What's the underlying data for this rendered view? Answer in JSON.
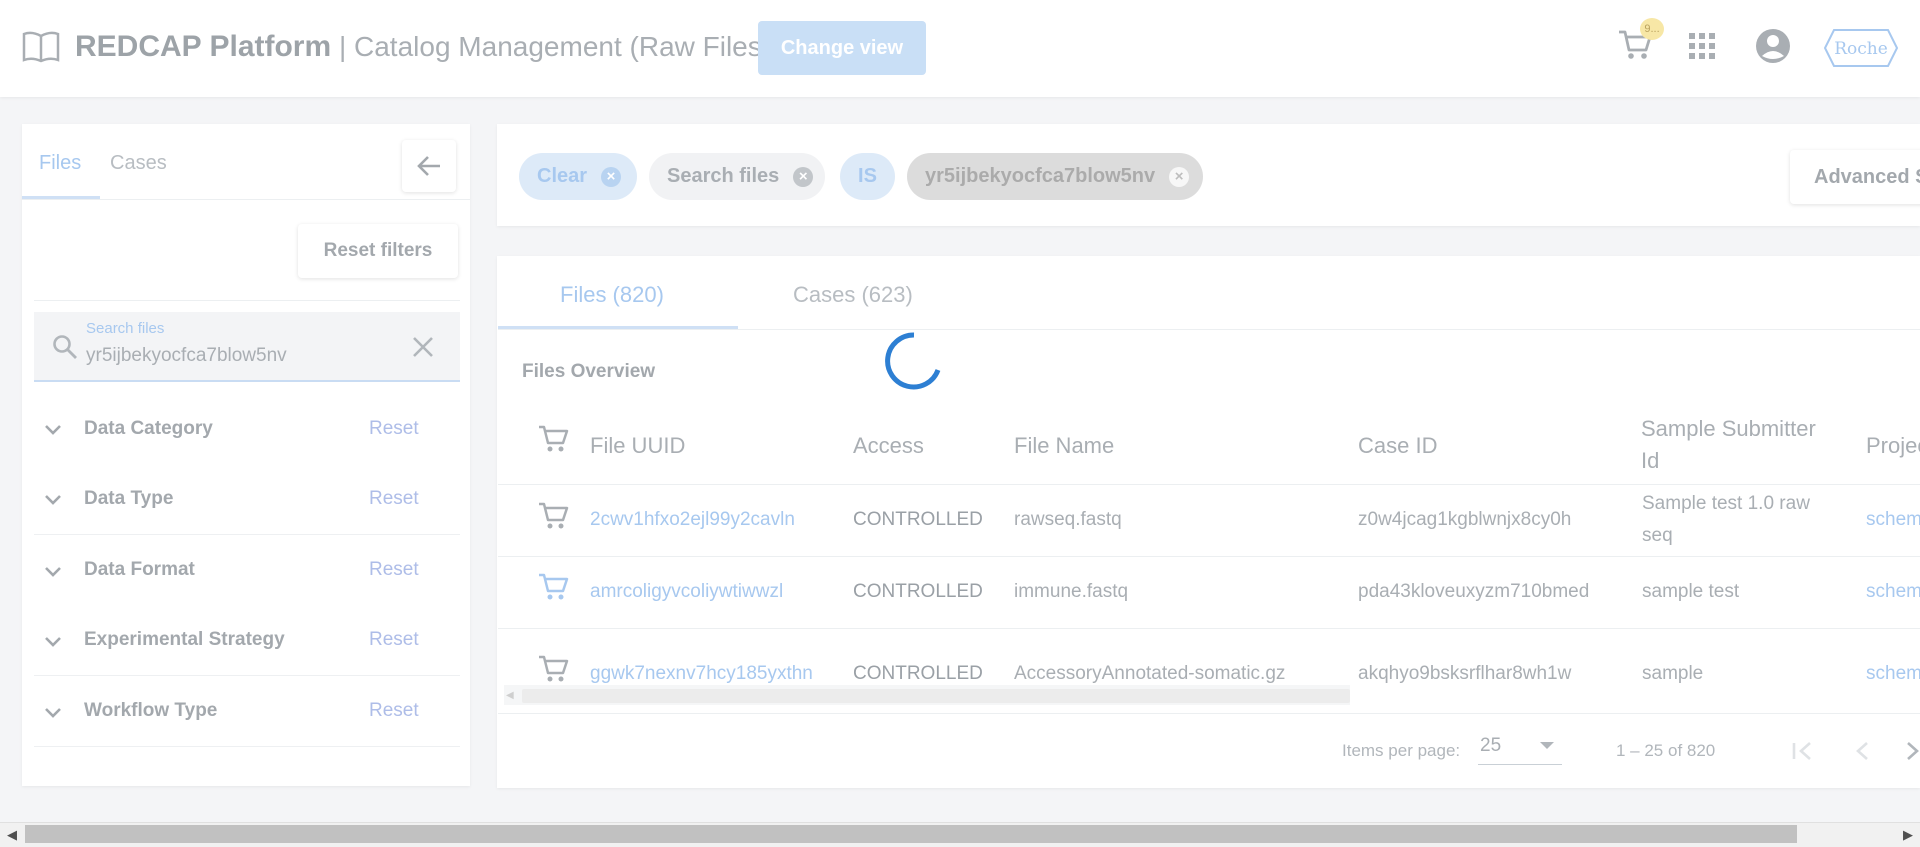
{
  "header": {
    "brand": "REDCAP Platform",
    "separator": " | ",
    "subtitle": "Catalog Management (Raw Files)",
    "change_view": "Change view",
    "cart_badge": "9...",
    "roche_logo": "Roche"
  },
  "left_panel": {
    "tabs": [
      "Files",
      "Cases"
    ],
    "active_tab": "Files",
    "reset_filters": "Reset filters",
    "search": {
      "label": "Search files",
      "value": "yr5ijbekyocfca7blow5nv"
    },
    "facets": [
      {
        "title": "Data Category",
        "reset": "Reset"
      },
      {
        "title": "Data Type",
        "reset": "Reset"
      },
      {
        "title": "Data Format",
        "reset": "Reset"
      },
      {
        "title": "Experimental Strategy",
        "reset": "Reset"
      },
      {
        "title": "Workflow Type",
        "reset": "Reset"
      }
    ]
  },
  "chips": {
    "clear": "Clear",
    "field": "Search files",
    "operator": "IS",
    "value": "yr5ijbekyocfca7blow5nv",
    "advanced": "Advanced Search"
  },
  "main": {
    "tabs": [
      "Files (820)",
      "Cases (623)"
    ],
    "active_tab": "Files (820)",
    "overview_title": "Files Overview",
    "columns": [
      "File UUID",
      "Access",
      "File Name",
      "Case ID",
      "Sample Submitter Id",
      "Project"
    ],
    "rows": [
      {
        "uuid": "2cwv1hfxo2ejl99y2cavln",
        "access": "CONTROLLED",
        "file_name": "rawseq.fastq",
        "case_id": "z0w4jcag1kgblwnjx8cy0h",
        "sample": [
          "Sample test 1.0 raw",
          "seq"
        ],
        "project": "schema"
      },
      {
        "uuid": "amrcoligyvcoliywtiwwzl",
        "access": "CONTROLLED",
        "file_name": "immune.fastq",
        "case_id": "pda43kloveuxyzm710bmed",
        "sample": [
          "sample test"
        ],
        "project": "schema"
      },
      {
        "uuid": "ggwk7nexnv7hcy185yxthn",
        "access": "CONTROLLED",
        "file_name": "AccessoryAnnotated-somatic.gz",
        "case_id": "akqhyo9bsksrflhar8wh1w",
        "sample": [
          "sample"
        ],
        "project": "schema"
      }
    ],
    "paginator": {
      "items_per_page_label": "Items per page:",
      "items_per_page": "25",
      "range": "1 – 25 of 820"
    }
  },
  "colors": {
    "accent": "#2d7fd3",
    "overlay": "rgba(255,255,255,0.65)"
  }
}
